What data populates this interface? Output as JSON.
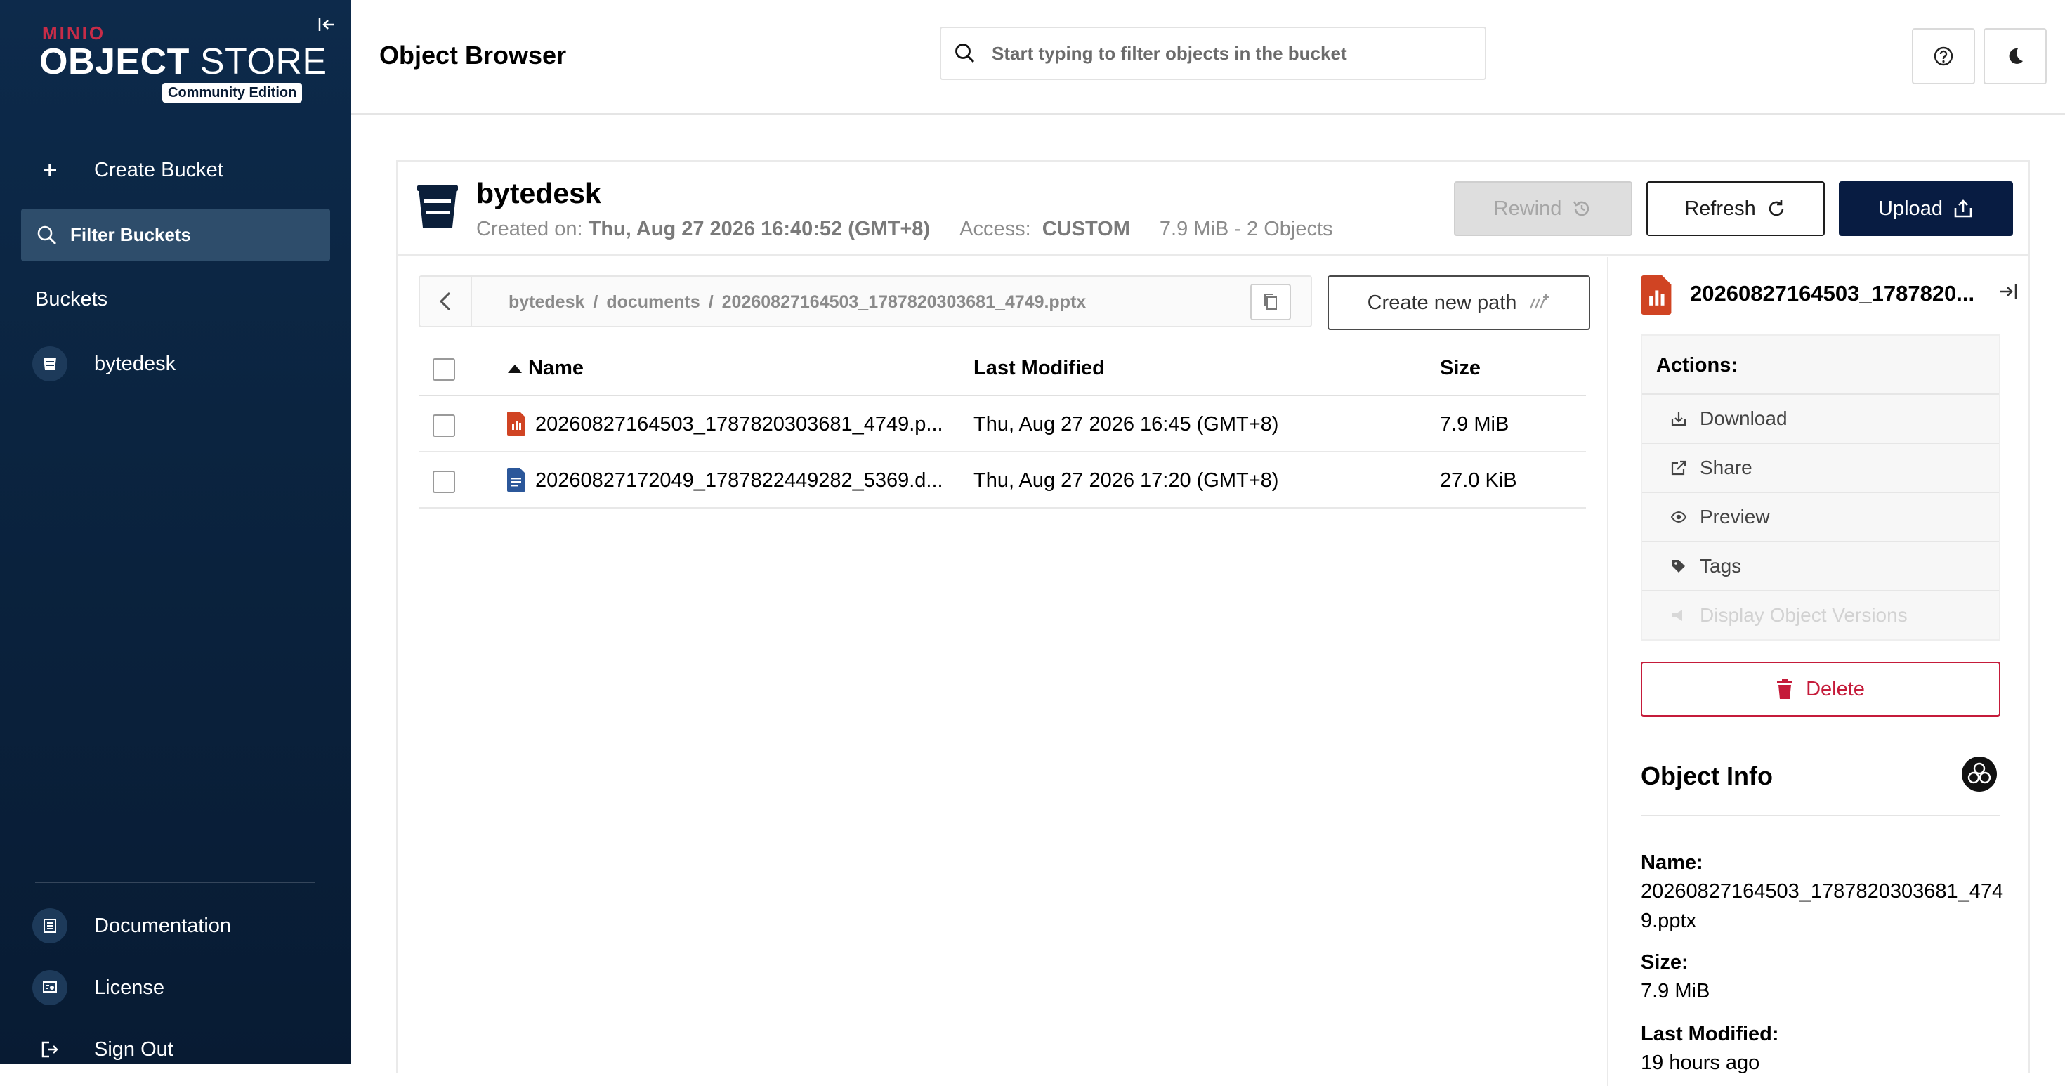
{
  "sidebar": {
    "logo": {
      "brand": "MINIO",
      "product_bold": "OBJECT",
      "product_light": "STORE",
      "edition": "Community Edition"
    },
    "create_bucket_label": "Create Bucket",
    "filter_placeholder": "Filter Buckets",
    "buckets_title": "Buckets",
    "buckets": [
      {
        "name": "bytedesk"
      }
    ],
    "documentation_label": "Documentation",
    "license_label": "License",
    "sign_out_label": "Sign Out"
  },
  "header": {
    "title": "Object Browser",
    "search_placeholder": "Start typing to filter objects in the bucket"
  },
  "bucket": {
    "name": "bytedesk",
    "created_prefix": "Created on:",
    "created_on": "Thu, Aug 27 2026 16:40:52 (GMT+8)",
    "access_prefix": "Access:",
    "access": "CUSTOM",
    "usage": "7.9 MiB - 2 Objects",
    "rewind_label": "Rewind",
    "refresh_label": "Refresh",
    "upload_label": "Upload"
  },
  "breadcrumb": {
    "parts": [
      "bytedesk",
      "documents",
      "20260827164503_1787820303681_4749.pptx"
    ],
    "separator": "/",
    "create_new_path_label": "Create new path"
  },
  "table": {
    "columns": {
      "name": "Name",
      "modified": "Last Modified",
      "size": "Size"
    },
    "rows": [
      {
        "name": "20260827164503_1787820303681_4749.p...",
        "modified": "Thu, Aug 27 2026 16:45 (GMT+8)",
        "size": "7.9 MiB",
        "type": "pptx",
        "color": "#d04423"
      },
      {
        "name": "20260827172049_1787822449282_5369.d...",
        "modified": "Thu, Aug 27 2026 17:20 (GMT+8)",
        "size": "27.0 KiB",
        "type": "docx",
        "color": "#2b579a"
      }
    ]
  },
  "detail": {
    "title": "20260827164503_1787820...",
    "actions_title": "Actions:",
    "actions": [
      {
        "label": "Download",
        "icon": "download-icon"
      },
      {
        "label": "Share",
        "icon": "share-icon"
      },
      {
        "label": "Preview",
        "icon": "eye-icon"
      },
      {
        "label": "Tags",
        "icon": "tag-icon"
      },
      {
        "label": "Display Object Versions",
        "icon": "versions-icon"
      }
    ],
    "delete_label": "Delete",
    "info_title": "Object Info",
    "name_label": "Name:",
    "name_value": "20260827164503_1787820303681_4749.pptx",
    "size_label": "Size:",
    "size_value": "7.9 MiB",
    "modified_label": "Last Modified:",
    "modified_value": "19 hours ago"
  },
  "colors": {
    "sidebar_bg": "#0b2440",
    "accent_dark": "#081c42",
    "danger": "#c51b3a",
    "brand_red": "#c72c48"
  }
}
